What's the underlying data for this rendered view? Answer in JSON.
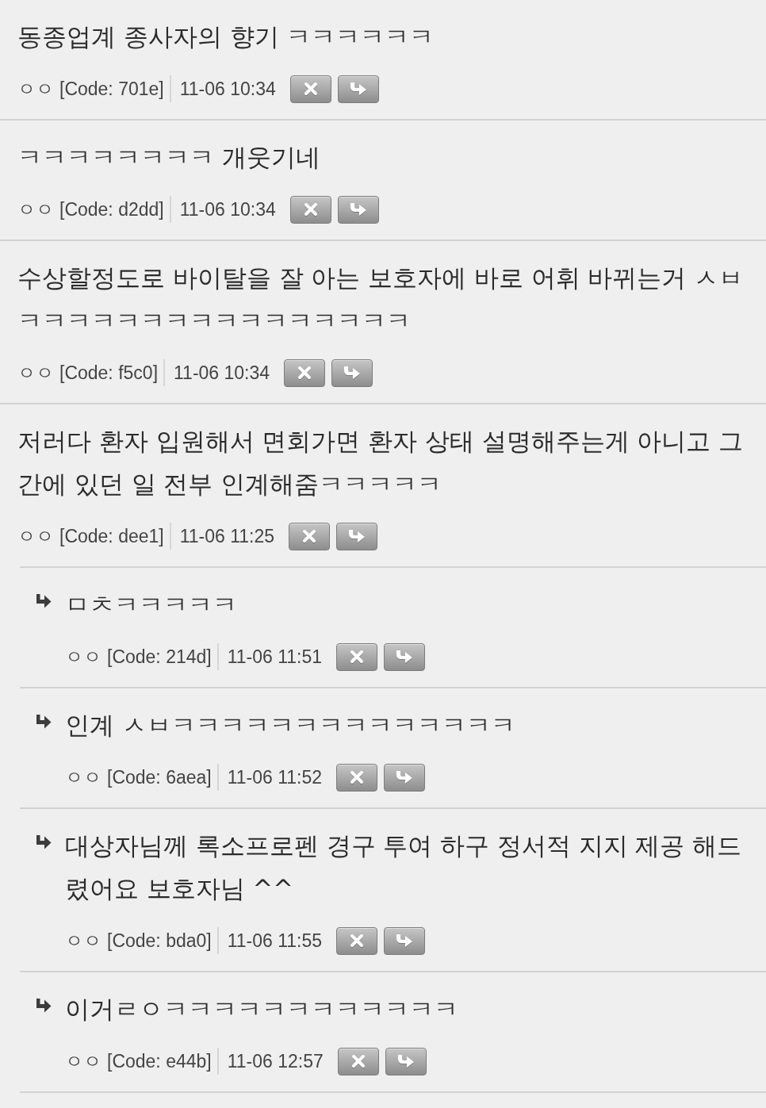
{
  "comments": [
    {
      "text": "동종업계 종사자의 향기 ㅋㅋㅋㅋㅋㅋ",
      "author": "ㅇㅇ",
      "code": "[Code: 701e]",
      "time": "11-06 10:34"
    },
    {
      "text": "ㅋㅋㅋㅋㅋㅋㅋㅋ 개웃기네",
      "author": "ㅇㅇ",
      "code": "[Code: d2dd]",
      "time": "11-06 10:34"
    },
    {
      "text": "수상할정도로 바이탈을 잘 아는 보호자에 바로 어휘 바뀌는거 ㅅㅂㅋㅋㅋㅋㅋㅋㅋㅋㅋㅋㅋㅋㅋㅋㅋㅋ",
      "author": "ㅇㅇ",
      "code": "[Code: f5c0]",
      "time": "11-06 10:34"
    },
    {
      "text": "저러다 환자 입원해서 면회가면 환자 상태 설명해주는게 아니고 그간에 있던 일 전부 인계해줌ㅋㅋㅋㅋㅋ",
      "author": "ㅇㅇ",
      "code": "[Code: dee1]",
      "time": "11-06 11:25",
      "children": [
        {
          "text": "ㅁㅊㅋㅋㅋㅋㅋ",
          "author": "ㅇㅇ",
          "code": "[Code: 214d]",
          "time": "11-06 11:51"
        },
        {
          "text": "인계 ㅅㅂㅋㅋㅋㅋㅋㅋㅋㅋㅋㅋㅋㅋㅋㅋ",
          "author": "ㅇㅇ",
          "code": "[Code: 6aea]",
          "time": "11-06 11:52"
        },
        {
          "text": "대상자님께 록소프로펜 경구 투여 하구 정서적 지지 제공 해드렸어요 보호자님 ^^",
          "author": "ㅇㅇ",
          "code": "[Code: bda0]",
          "time": "11-06 11:55"
        },
        {
          "text": "이거ㄹㅇㅋㅋㅋㅋㅋㅋㅋㅋㅋㅋㅋㅋ",
          "author": "ㅇㅇ",
          "code": "[Code: e44b]",
          "time": "11-06 12:57"
        }
      ]
    }
  ]
}
